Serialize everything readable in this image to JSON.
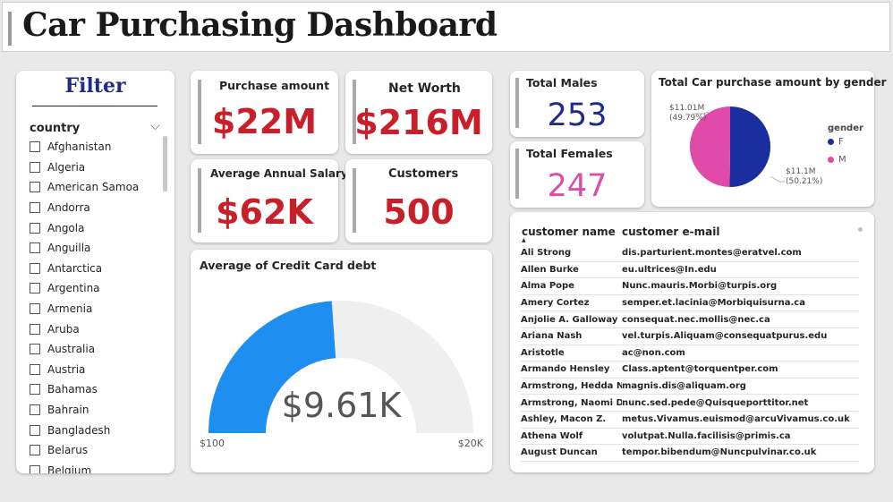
{
  "header": {
    "title": "Car Purchasing Dashboard"
  },
  "filter": {
    "title": "Filter",
    "slicer_label": "country",
    "countries": [
      "Afghanistan",
      "Algeria",
      "American Samoa",
      "Andorra",
      "Angola",
      "Anguilla",
      "Antarctica",
      "Argentina",
      "Armenia",
      "Aruba",
      "Australia",
      "Austria",
      "Bahamas",
      "Bahrain",
      "Bangladesh",
      "Belarus",
      "Belgium"
    ]
  },
  "kpis": {
    "purchase": {
      "label": "Purchase amount",
      "value": "$22M"
    },
    "networth": {
      "label": "Net Worth",
      "value": "$216M"
    },
    "salary": {
      "label": "Average Annual Salary",
      "value": "$62K"
    },
    "customers": {
      "label": "Customers",
      "value": "500"
    }
  },
  "gauge": {
    "title": "Average of Credit Card debt",
    "value_text": "$9.61K",
    "min_text": "$100",
    "max_text": "$20K",
    "min": 100,
    "max": 20000,
    "value": 9610,
    "fill_color": "#1f8ef1",
    "track_color": "#f0efef"
  },
  "gender": {
    "males": {
      "label": "Total Males",
      "value": "253",
      "color": "#1f2b85"
    },
    "females": {
      "label": "Total Females",
      "value": "247",
      "color": "#d94fa8"
    }
  },
  "chart_data": {
    "type": "pie",
    "title": "Total Car purchase amount by gender",
    "legend_title": "gender",
    "legend_position": "right",
    "categories": [
      "F",
      "M"
    ],
    "values": [
      11.1,
      11.01
    ],
    "value_labels": [
      "$11.1M",
      "$11.01M"
    ],
    "percent_labels": [
      "(50.21%)",
      "(49.79%)"
    ],
    "colors": [
      "#1a2ea0",
      "#e04aa8"
    ]
  },
  "table": {
    "columns": [
      "customer name",
      "customer e-mail"
    ],
    "rows": [
      [
        "Ali Strong",
        "dis.parturient.montes@eratvel.com"
      ],
      [
        "Allen Burke",
        "eu.ultrices@In.edu"
      ],
      [
        "Alma Pope",
        "Nunc.mauris.Morbi@turpis.org"
      ],
      [
        "Amery Cortez",
        "semper.et.lacinia@Morbiquisurna.ca"
      ],
      [
        "Anjolie A. Galloway",
        "consequat.nec.mollis@nec.ca"
      ],
      [
        "Ariana Nash",
        "vel.turpis.Aliquam@consequatpurus.edu"
      ],
      [
        "Aristotle",
        "ac@non.com"
      ],
      [
        "Armando Hensley",
        "Class.aptent@torquentper.com"
      ],
      [
        "Armstrong, Hedda N.",
        "magnis.dis@aliquam.org"
      ],
      [
        "Armstrong, Naomi D.",
        "nunc.sed.pede@Quisqueporttitor.net"
      ],
      [
        "Ashley, Macon Z.",
        "metus.Vivamus.euismod@arcuVivamus.co.uk"
      ],
      [
        "Athena Wolf",
        "volutpat.Nulla.facilisis@primis.ca"
      ],
      [
        "August Duncan",
        "tempor.bibendum@Nuncpulvinar.co.uk"
      ]
    ]
  }
}
